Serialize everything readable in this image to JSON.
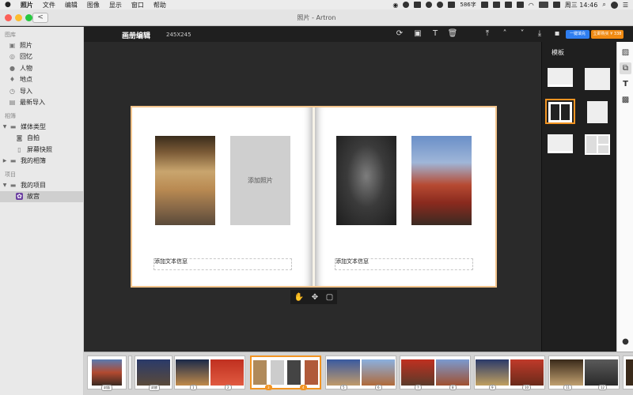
{
  "menubar": {
    "app": "照片",
    "menus": [
      "文件",
      "编辑",
      "图像",
      "显示",
      "窗口",
      "帮助"
    ],
    "status_chars": "586字",
    "datetime": "周三 14:46"
  },
  "window": {
    "title": "照片 - Artron",
    "back_glyph": "<"
  },
  "sidebar": {
    "library_header": "图库",
    "library_items": [
      {
        "label": "照片",
        "icon": "photos-icon"
      },
      {
        "label": "回忆",
        "icon": "memories-icon"
      },
      {
        "label": "人物",
        "icon": "people-icon"
      },
      {
        "label": "地点",
        "icon": "places-icon"
      },
      {
        "label": "导入",
        "icon": "import-icon"
      },
      {
        "label": "最新导入",
        "icon": "recent-import-icon"
      }
    ],
    "albums_header": "相簿",
    "media_types": "媒体类型",
    "selfie": "自拍",
    "screenshot": "屏幕快照",
    "my_albums": "我的相簿",
    "projects_header": "项目",
    "my_projects": "我的项目",
    "project_item": "故宫"
  },
  "toolbar": {
    "title": "画册编辑",
    "size": "245X245",
    "fill_btn": "一键填充",
    "buy_btn": "立即购买 ¥ 338"
  },
  "spread": {
    "add_photo": "添加照片",
    "left_text": "添加文本信息",
    "right_text": "添加文本信息"
  },
  "panel": {
    "title": "模板"
  },
  "filmstrip": {
    "labels": [
      "封面",
      "封底",
      "1",
      "2",
      "3",
      "4",
      "5",
      "6",
      "7",
      "8",
      "9",
      "10",
      "11",
      "12"
    ]
  },
  "colors": {
    "accent": "#f29422",
    "fill_btn": "#2f7ef0",
    "buy_btn": "#f08a12"
  }
}
